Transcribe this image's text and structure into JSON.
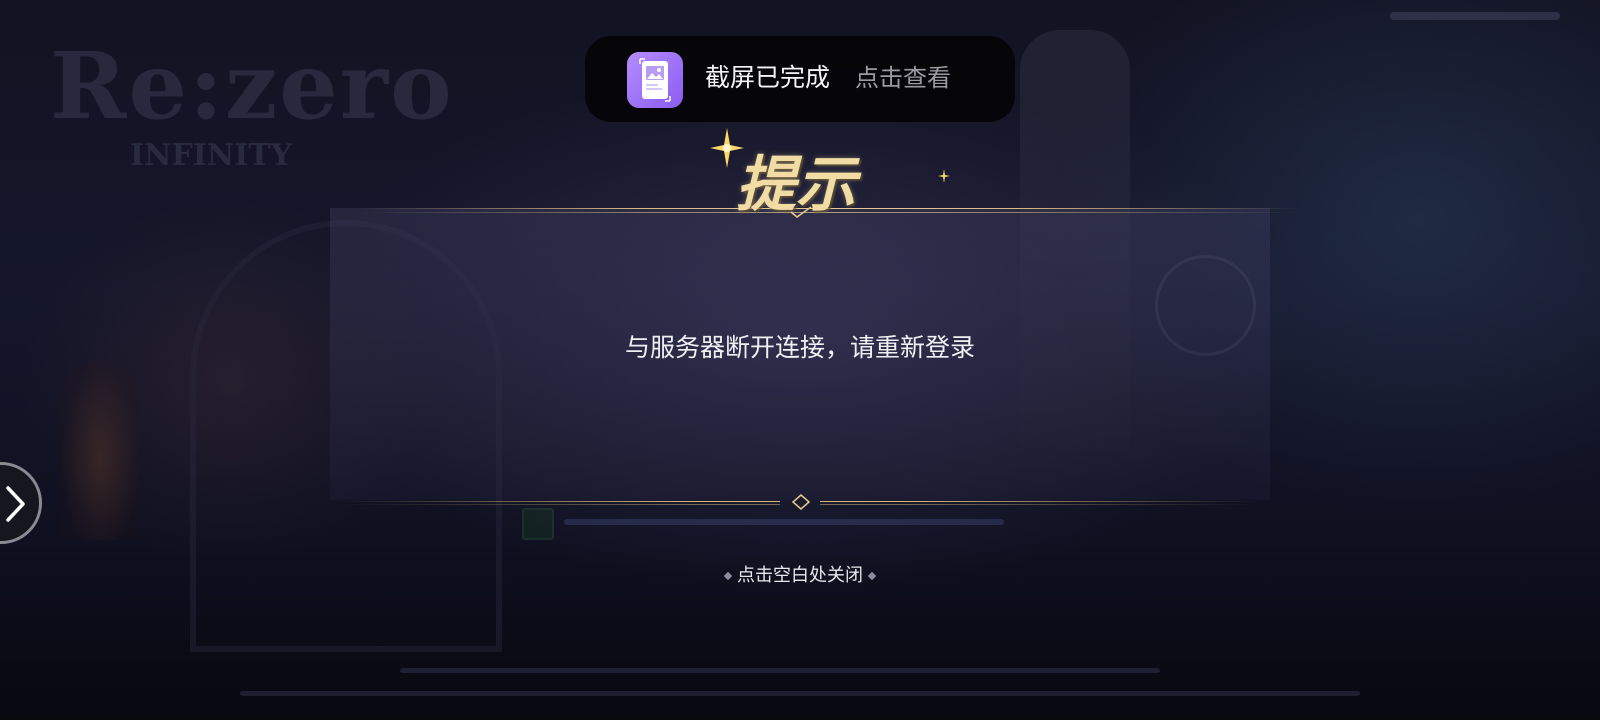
{
  "background": {
    "logo_text": "Re:zero",
    "logo_subtitle": "INFINITY"
  },
  "toast": {
    "icon": "screenshot-gallery-icon",
    "title": "截屏已完成",
    "action": "点击查看",
    "icon_color": "#9b6cf5"
  },
  "dialog": {
    "title": "提示",
    "message": "与服务器断开连接，请重新登录",
    "close_hint": "点击空白处关闭",
    "accent_color": "#d7b97a"
  },
  "side_button": {
    "icon": "chevron-right-icon"
  }
}
